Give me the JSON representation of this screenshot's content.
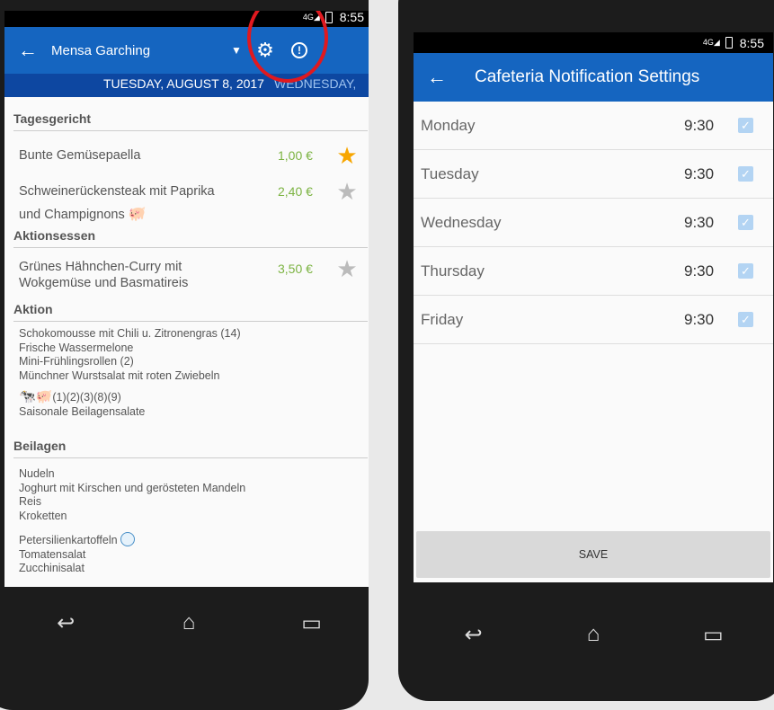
{
  "left": {
    "status_time": "8:55",
    "app_title": "Mensa Garching",
    "day_current": "TUESDAY, AUGUST 8, 2017",
    "day_next": "WEDNESDAY,",
    "sections": {
      "tagesgericht": "Tagesgericht",
      "aktionsessen": "Aktionsessen",
      "aktion": "Aktion",
      "beilagen": "Beilagen"
    },
    "dishes": [
      {
        "name": "Bunte Gemüsepaella",
        "price": "1,00 €"
      },
      {
        "name": "Schweinerückensteak mit Paprika",
        "name2": "und Champignons",
        "price": "2,40 €"
      },
      {
        "name": "Grünes Hähnchen-Curry mit",
        "name2": "Wokgemüse und Basmatireis",
        "price": "3,50 €"
      }
    ],
    "aktion_items": [
      "Schokomousse mit Chili u. Zitronengras (14)",
      "Frische Wassermelone",
      "Mini-Frühlingsrollen (2)",
      "Münchner Wurstsalat mit roten Zwiebeln",
      "(1)(2)(3)(8)(9)",
      "Saisonale Beilagensalate"
    ],
    "beilagen_items": [
      "Nudeln",
      "Joghurt mit Kirschen und gerösteten Mandeln",
      "Reis",
      "Kroketten",
      "Petersilienkartoffeln",
      "Tomatensalat",
      "Zucchinisalat"
    ]
  },
  "right": {
    "status_time": "8:55",
    "app_title": "Cafeteria Notification Settings",
    "rows": [
      {
        "day": "Monday",
        "time": "9:30"
      },
      {
        "day": "Tuesday",
        "time": "9:30"
      },
      {
        "day": "Wednesday",
        "time": "9:30"
      },
      {
        "day": "Thursday",
        "time": "9:30"
      },
      {
        "day": "Friday",
        "time": "9:30"
      }
    ],
    "save_label": "SAVE"
  },
  "colors": {
    "appbar": "#1565c0",
    "annotation_circle": "#e0191f",
    "price": "#7cb342"
  }
}
